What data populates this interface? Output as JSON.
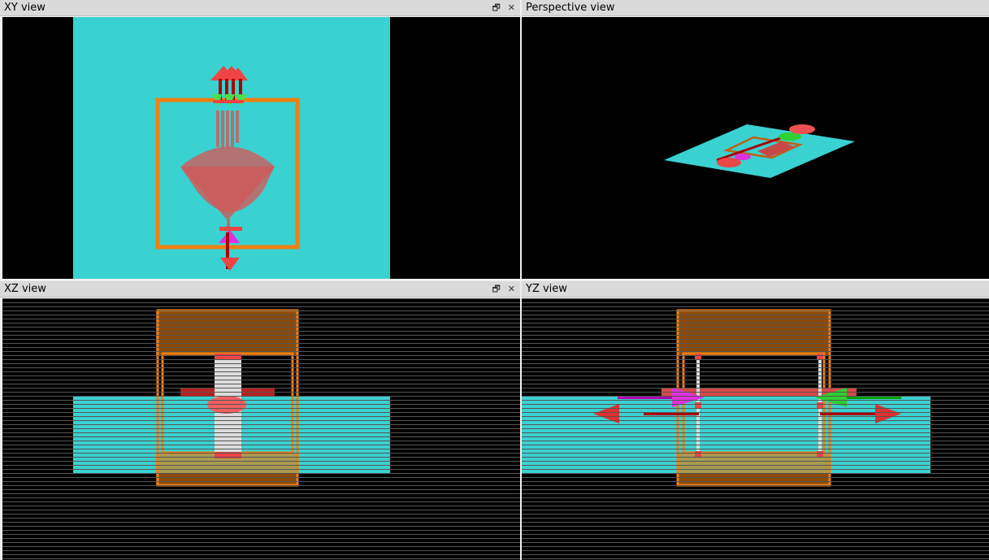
{
  "panes": [
    {
      "title": "XY view",
      "buttons": {
        "restore": "🗗",
        "close": "✕"
      }
    },
    {
      "title": "Perspective view"
    },
    {
      "title": "XZ view",
      "buttons": {
        "restore": "🗗",
        "close": "✕"
      }
    },
    {
      "title": "YZ view"
    }
  ],
  "colors": {
    "background": "#000000",
    "substrate": "#3ad1d1",
    "frame": "#f08010",
    "ray": "#e84848",
    "green": "#30d030",
    "magenta": "#e030e0"
  }
}
